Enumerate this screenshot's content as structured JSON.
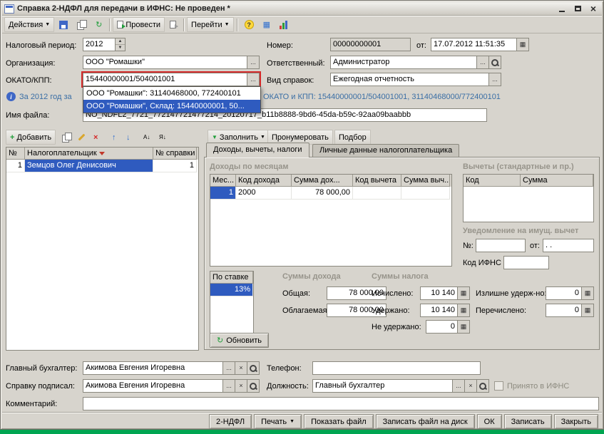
{
  "titlebar": {
    "title": "Справка 2-НДФЛ для передачи в ИФНС: Не проведен *"
  },
  "toolbar": {
    "actions_label": "Действия",
    "post_label": "Провести",
    "goto_label": "Перейти"
  },
  "header": {
    "tax_period_label": "Налоговый период:",
    "tax_period_value": "2012",
    "number_label": "Номер:",
    "number_value": "00000000001",
    "date_label": "от:",
    "date_value": "17.07.2012 11:51:35",
    "org_label": "Организация:",
    "org_value": "ООО \"Ромашки\"",
    "responsible_label": "Ответственный:",
    "responsible_value": "Администратор",
    "okato_label": "ОКАТО/КПП:",
    "okato_value": "15440000001/504001001",
    "vid_label": "Вид справок:",
    "vid_value": "Ежегодная отчетность",
    "info_prefix": "За 2012 год за",
    "info_okato": "ОКАТО и КПП: 15440000001/504001001, 31140468000/772400101",
    "filename_label": "Имя файла:",
    "filename_value": "NO_NDFL2_7721_772147721477214_20120717_b11b8888-9bd6-45da-b59c-92aa09baabbb"
  },
  "okato_dropdown": {
    "item1": "ООО \"Ромашки\": 31140468000, 772400101",
    "item2": "ООО \"Ромашки\", Склад: 15440000001, 50..."
  },
  "employees": {
    "add_label": "Добавить",
    "col_num": "№",
    "col_name": "Налогоплательщик",
    "col_cert": "№ справки",
    "row1": {
      "num": "1",
      "name": "Земцов Олег Денисович",
      "cert": "1"
    }
  },
  "actions_bar": {
    "fill_label": "Заполнить",
    "number_label": "Пронумеровать",
    "pick_label": "Подбор"
  },
  "tabs": {
    "active": "Доходы, вычеты, налоги",
    "inactive": "Личные данные налогоплательщика"
  },
  "income": {
    "title": "Доходы по месяцам",
    "col_month": "Мес...",
    "col_code": "Код дохода",
    "col_sum": "Сумма дох...",
    "col_dcode": "Код вычета",
    "col_dsum": "Сумма выч...",
    "row1": {
      "month": "1",
      "code": "2000",
      "sum": "78 000,00",
      "dcode": "",
      "dsum": ""
    }
  },
  "deductions": {
    "title": "Вычеты (стандартные и пр.)",
    "col_code": "Код",
    "col_sum": "Сумма"
  },
  "notice": {
    "title": "Уведомление на имущ. вычет",
    "num_label": "№:",
    "num_value": "",
    "from_label": "от:",
    "date_value": " .  .",
    "ifns_label": "Код ИФНС",
    "ifns_value": ""
  },
  "rate": {
    "header": "По ставке",
    "value": "13%"
  },
  "sums_income": {
    "title": "Суммы дохода",
    "total_label": "Общая:",
    "total_value": "78 000,00",
    "taxable_label": "Облагаемая:",
    "taxable_value": "78 000,00"
  },
  "sums_tax": {
    "title": "Суммы налога",
    "calc_label": "Исчислено:",
    "calc_value": "10 140",
    "withheld_label": "Удержано:",
    "withheld_value": "10 140",
    "not_withheld_label": "Не удержано:",
    "not_withheld_value": "0",
    "over_label": "Излишне удерж-но:",
    "over_value": "0",
    "transferred_label": "Перечислено:",
    "transferred_value": "0"
  },
  "refresh_label": "Обновить",
  "bottom": {
    "chief_label": "Главный бухгалтер:",
    "chief_value": "Акимова Евгения Игоревна",
    "phone_label": "Телефон:",
    "phone_value": "",
    "signed_label": "Справку подписал:",
    "signed_value": "Акимова Евгения Игоревна",
    "position_label": "Должность:",
    "position_value": "Главный бухгалтер",
    "accepted_label": "Принято в ИФНС",
    "comment_label": "Комментарий:",
    "comment_value": ""
  },
  "footer": {
    "ndfl_label": "2-НДФЛ",
    "print_label": "Печать",
    "show_file_label": "Показать файл",
    "save_file_label": "Записать файл на диск",
    "ok_label": "ОК",
    "save_label": "Записать",
    "close_label": "Закрыть"
  },
  "icons": {
    "ellipsis": "...",
    "arrow_down": "▼",
    "spin_up": "▲",
    "spin_down": "▼",
    "clear": "×",
    "calc": "▦",
    "calendar": "▦",
    "info": "i",
    "help": "?",
    "add": "+",
    "delete": "×",
    "move_up": "↑",
    "move_down": "↓",
    "sort_asc": "А↓",
    "sort_desc": "Я↓",
    "refresh": "↻",
    "grid": "▦"
  }
}
